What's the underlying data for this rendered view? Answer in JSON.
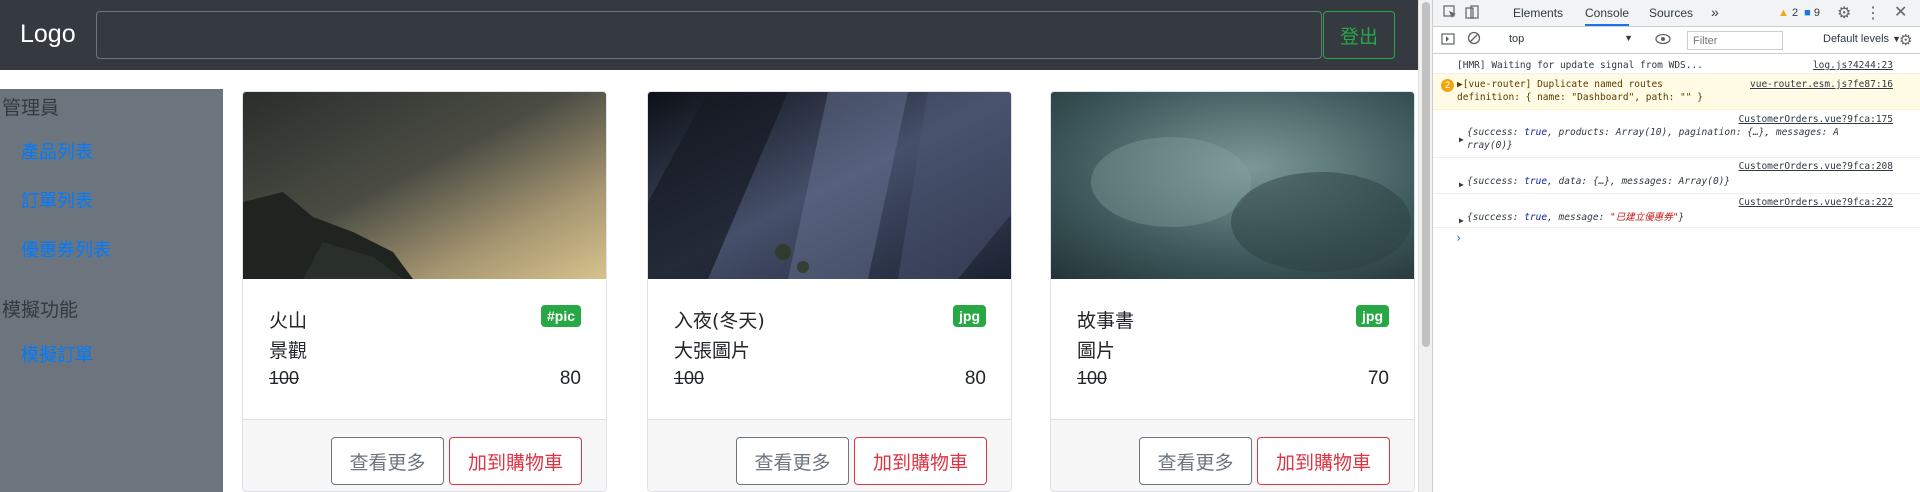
{
  "navbar": {
    "brand": "Logo",
    "search_value": "",
    "logout_label": "登出"
  },
  "sidebar": {
    "admin_heading": "管理員",
    "admin_links": [
      "產品列表",
      "訂單列表",
      "優惠券列表"
    ],
    "sim_heading": "模擬功能",
    "sim_links": [
      "模擬訂單"
    ]
  },
  "products": [
    {
      "title": "火山",
      "subtitle": "景觀",
      "badge": "#pic",
      "original_price": "100",
      "price": "80",
      "more_label": "查看更多",
      "cart_label": "加到購物車"
    },
    {
      "title": "入夜(冬天)",
      "subtitle": "大張圖片",
      "badge": "jpg",
      "original_price": "100",
      "price": "80",
      "more_label": "查看更多",
      "cart_label": "加到購物車"
    },
    {
      "title": "故事書",
      "subtitle": "圖片",
      "badge": "jpg",
      "original_price": "100",
      "price": "70",
      "more_label": "查看更多",
      "cart_label": "加到購物車"
    }
  ],
  "devtools": {
    "tabs": [
      "Elements",
      "Console",
      "Sources"
    ],
    "more_tabs": "»",
    "warning_count": "2",
    "message_count": "9",
    "context": "top",
    "filter_placeholder": "Filter",
    "levels": "Default levels",
    "logs": [
      {
        "text": "[HMR] Waiting for update signal from WDS...",
        "source": "log.js?4244:23"
      },
      {
        "count": "2",
        "text": "▶[vue-router] Duplicate named routes",
        "text2": "definition: { name: \"Dashboard\", path: \"\" }",
        "source": "vue-router.esm.js?fe87:16"
      },
      {
        "source": "CustomerOrders.vue?9fca:175"
      },
      {
        "source": "CustomerOrders.vue?9fca:208"
      },
      {
        "source": "CustomerOrders.vue?9fca:222"
      }
    ]
  },
  "colors": {
    "navbar": "#343a40",
    "sidebar": "#6c757d",
    "success": "#28a745",
    "danger": "#dc3545",
    "link": "#007bff"
  }
}
